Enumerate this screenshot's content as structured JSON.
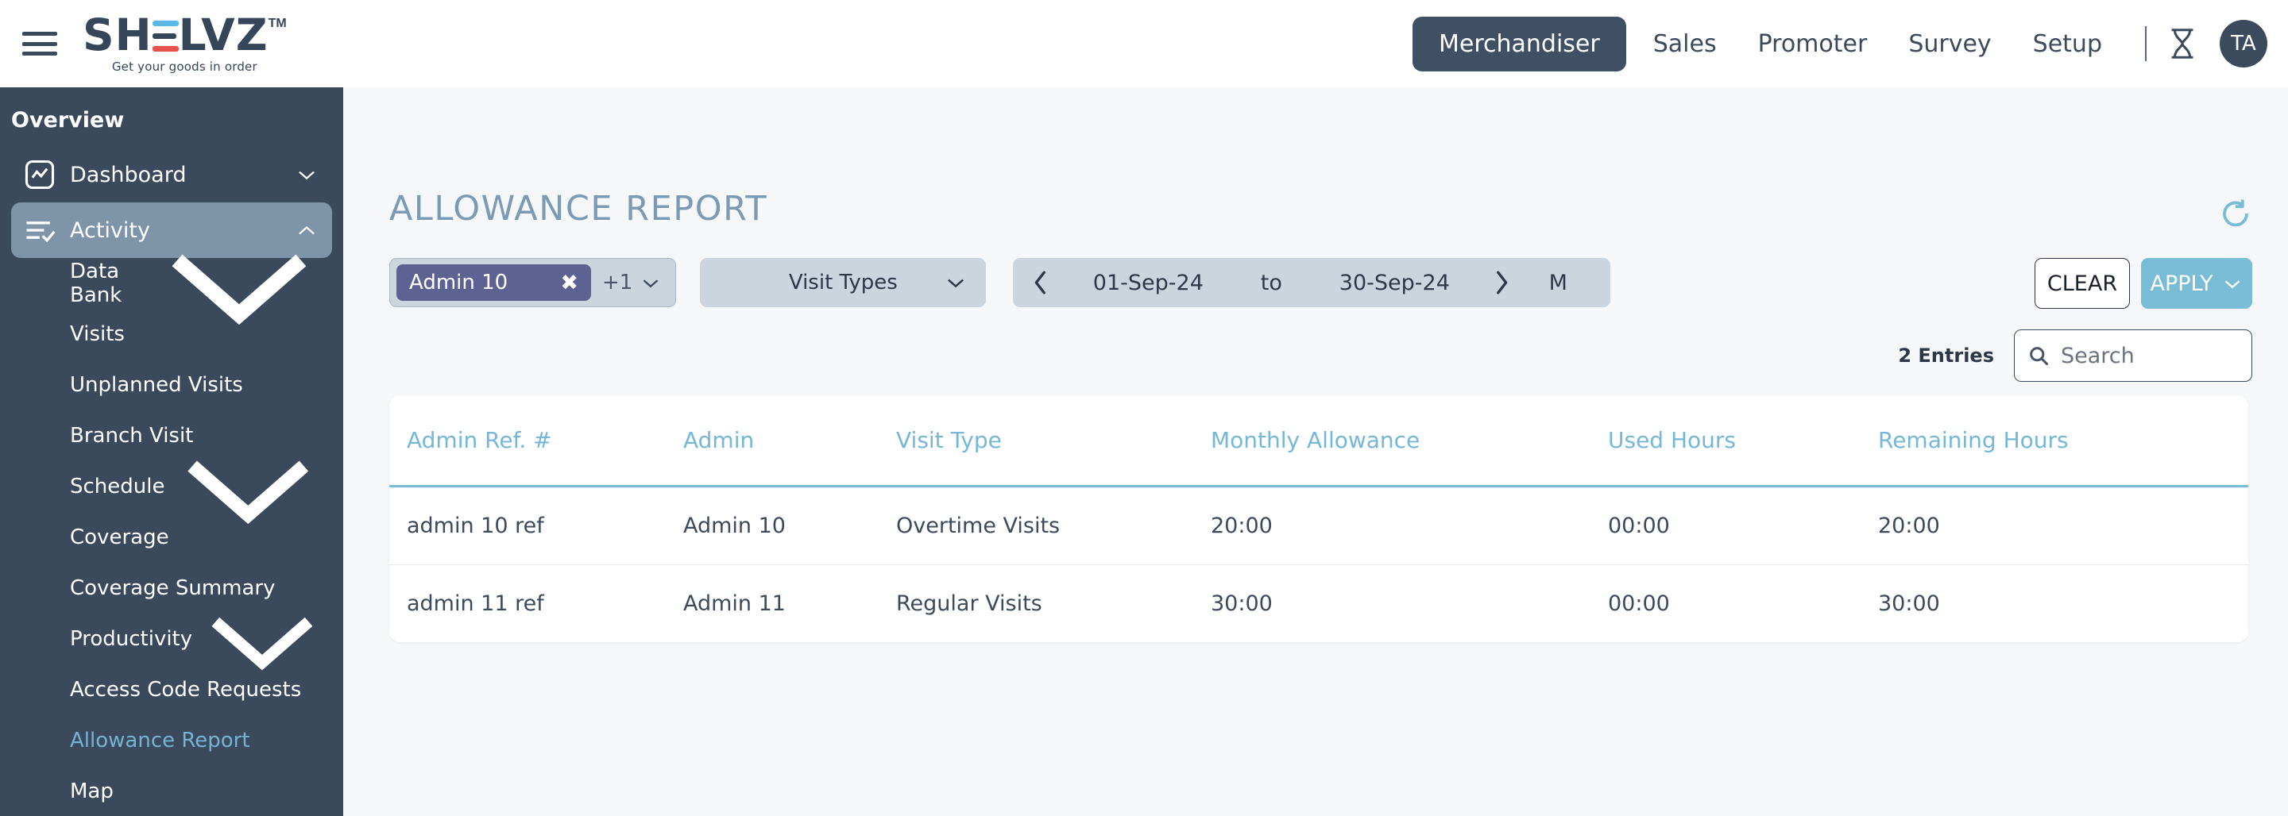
{
  "header": {
    "menu_icon": "hamburger-icon",
    "logo": {
      "text_before": "SH",
      "text_after": "LVZ",
      "tm": "TM",
      "tagline": "Get your goods in order"
    },
    "nav": [
      {
        "label": "Merchandiser",
        "active": true
      },
      {
        "label": "Sales",
        "active": false
      },
      {
        "label": "Promoter",
        "active": false
      },
      {
        "label": "Survey",
        "active": false
      },
      {
        "label": "Setup",
        "active": false
      }
    ],
    "timer_icon": "hourglass-icon",
    "avatar_initials": "TA"
  },
  "sidebar": {
    "section_title": "Overview",
    "items": [
      {
        "label": "Dashboard",
        "icon": "dashboard-chart-icon",
        "chevron": "down",
        "active": false
      },
      {
        "label": "Activity",
        "icon": "activity-list-check-icon",
        "chevron": "up",
        "active": true
      }
    ],
    "sub_items": [
      {
        "label": "Data Bank",
        "chevron": "down",
        "current": false
      },
      {
        "label": "Visits",
        "chevron": "",
        "current": false
      },
      {
        "label": "Unplanned Visits",
        "chevron": "",
        "current": false
      },
      {
        "label": "Branch Visit",
        "chevron": "",
        "current": false
      },
      {
        "label": "Schedule",
        "chevron": "down",
        "current": false
      },
      {
        "label": "Coverage",
        "chevron": "",
        "current": false
      },
      {
        "label": "Coverage Summary",
        "chevron": "",
        "current": false
      },
      {
        "label": "Productivity",
        "chevron": "down",
        "current": false
      },
      {
        "label": "Access Code Requests",
        "chevron": "",
        "current": false
      },
      {
        "label": "Allowance Report",
        "chevron": "",
        "current": true
      },
      {
        "label": "Map",
        "chevron": "",
        "current": false
      }
    ]
  },
  "page": {
    "title": "ALLOWANCE REPORT",
    "refresh_icon": "refresh-icon"
  },
  "filters": {
    "admin_chip": {
      "label": "Admin 10",
      "remove_icon": "close-icon",
      "more_count": "+1"
    },
    "visit_types": {
      "label": "Visit Types"
    },
    "date_range": {
      "prev_icon": "chevron-left-icon",
      "from": "01-Sep-24",
      "separator": "to",
      "to": "30-Sep-24",
      "next_icon": "chevron-right-icon",
      "mode": "M"
    },
    "clear_label": "CLEAR",
    "apply_label": "APPLY"
  },
  "toolbar": {
    "entries_label": "2 Entries",
    "search_placeholder": "Search",
    "search_value": "",
    "search_icon": "search-icon"
  },
  "table": {
    "columns": [
      "Admin Ref. #",
      "Admin",
      "Visit Type",
      "Monthly Allowance",
      "Used Hours",
      "Remaining Hours"
    ],
    "rows": [
      {
        "admin_ref": "admin 10 ref",
        "admin": "Admin 10",
        "visit_type": "Overtime Visits",
        "monthly_allowance": "20:00",
        "used_hours": "00:00",
        "remaining_hours": "20:00"
      },
      {
        "admin_ref": "admin 11 ref",
        "admin": "Admin 11",
        "visit_type": "Regular Visits",
        "monthly_allowance": "30:00",
        "used_hours": "00:00",
        "remaining_hours": "30:00"
      }
    ]
  },
  "colors": {
    "sidebar_bg": "#3a4a5c",
    "accent_blue": "#79bcd5",
    "chip_purple": "#5d6292",
    "content_bg": "#f5f7f9",
    "active_nav": "#3f5065",
    "sidebar_active": "#7e94a9",
    "current_link": "#76b3d3"
  }
}
